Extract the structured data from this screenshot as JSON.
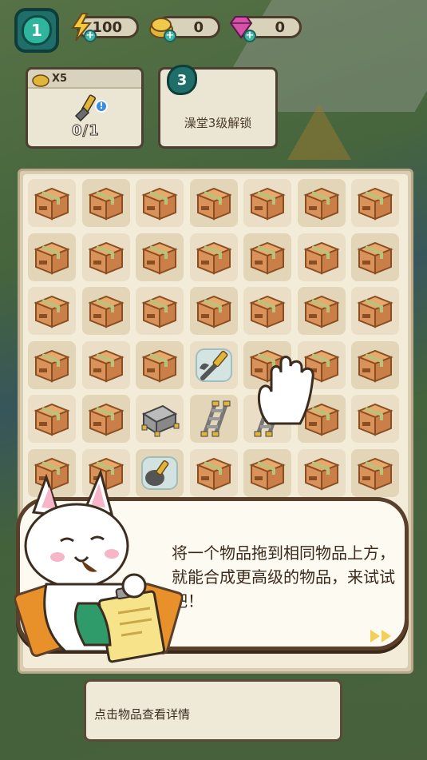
{
  "hud": {
    "level": "1",
    "energy": {
      "icon": "lightning-icon",
      "value": "100"
    },
    "coins": {
      "icon": "coin-stack-icon",
      "value": "0"
    },
    "gems": {
      "icon": "gem-icon",
      "value": "0"
    }
  },
  "tasks": [
    {
      "reward_label": "X5",
      "item_icon": "wrench-screwdriver-icon",
      "progress_text": "0/1"
    },
    {
      "unlock_level": "3",
      "lock_text": "澡堂3级解锁"
    }
  ],
  "board": {
    "rows": [
      [
        "box",
        "box",
        "box",
        "box",
        "box",
        "box",
        "box"
      ],
      [
        "box",
        "box",
        "box",
        "box",
        "box",
        "box",
        "box"
      ],
      [
        "box",
        "box",
        "box",
        "box",
        "box",
        "box",
        "box"
      ],
      [
        "box",
        "box",
        "box",
        "tool-wrench",
        "box",
        "box",
        "box"
      ],
      [
        "box",
        "box",
        "frame",
        "ladder",
        "ladder",
        "box",
        "box"
      ],
      [
        "box",
        "box",
        "tool-brush",
        "box",
        "box",
        "box",
        "box"
      ]
    ]
  },
  "tutorial": {
    "text": "将一个物品拖到相同物品上方，就能合成更高级的物品，来试试吧！",
    "skip_icon": "fast-forward-icon"
  },
  "info_bar": {
    "text": "点击物品查看详情"
  },
  "colors": {
    "box": "#d9935a",
    "panel_border": "#5a3f2a",
    "teal": "#1f6e69"
  }
}
